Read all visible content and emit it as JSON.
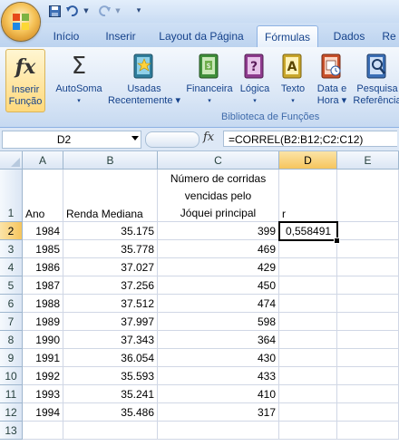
{
  "quick_access": {
    "save_icon": "save-icon",
    "undo_icon": "undo-icon",
    "redo_icon": "redo-icon"
  },
  "tabs": [
    {
      "label": "Início"
    },
    {
      "label": "Inserir"
    },
    {
      "label": "Layout da Página"
    },
    {
      "label": "Fórmulas",
      "active": true
    },
    {
      "label": "Dados"
    },
    {
      "label": "Re"
    }
  ],
  "ribbon": {
    "group_label": "Biblioteca de Funções",
    "buttons": [
      {
        "line1": "Inserir",
        "line2": "Função"
      },
      {
        "line1": "AutoSoma",
        "line2": "▾"
      },
      {
        "line1": "Usadas",
        "line2": "Recentemente ▾"
      },
      {
        "line1": "Financeira",
        "line2": "▾"
      },
      {
        "line1": "Lógica",
        "line2": "▾"
      },
      {
        "line1": "Texto",
        "line2": "▾"
      },
      {
        "line1": "Data e",
        "line2": "Hora ▾"
      },
      {
        "line1": "Pesquisa",
        "line2": "Referência"
      }
    ]
  },
  "formula_bar": {
    "name_box": "D2",
    "fx": "fx",
    "formula": "=CORREL(B2:B12;C2:C12)"
  },
  "sheet": {
    "columns": [
      "A",
      "B",
      "C",
      "D",
      "E"
    ],
    "header_row": {
      "A": "Ano",
      "B": "Renda Mediana",
      "C1": "Número de corridas",
      "C2": "vencidas pelo",
      "C3": "Jóquei principal",
      "D": "r"
    },
    "rows": [
      {
        "n": "2",
        "a": "1984",
        "b": "35.175",
        "c": "399",
        "d": "0,558491"
      },
      {
        "n": "3",
        "a": "1985",
        "b": "35.778",
        "c": "469",
        "d": ""
      },
      {
        "n": "4",
        "a": "1986",
        "b": "37.027",
        "c": "429",
        "d": ""
      },
      {
        "n": "5",
        "a": "1987",
        "b": "37.256",
        "c": "450",
        "d": ""
      },
      {
        "n": "6",
        "a": "1988",
        "b": "37.512",
        "c": "474",
        "d": ""
      },
      {
        "n": "7",
        "a": "1989",
        "b": "37.997",
        "c": "598",
        "d": ""
      },
      {
        "n": "8",
        "a": "1990",
        "b": "37.343",
        "c": "364",
        "d": ""
      },
      {
        "n": "9",
        "a": "1991",
        "b": "36.054",
        "c": "430",
        "d": ""
      },
      {
        "n": "10",
        "a": "1992",
        "b": "35.593",
        "c": "433",
        "d": ""
      },
      {
        "n": "11",
        "a": "1993",
        "b": "35.241",
        "c": "410",
        "d": ""
      },
      {
        "n": "12",
        "a": "1994",
        "b": "35.486",
        "c": "317",
        "d": ""
      },
      {
        "n": "13",
        "a": "",
        "b": "",
        "c": "",
        "d": ""
      }
    ],
    "row1_label": "1"
  }
}
